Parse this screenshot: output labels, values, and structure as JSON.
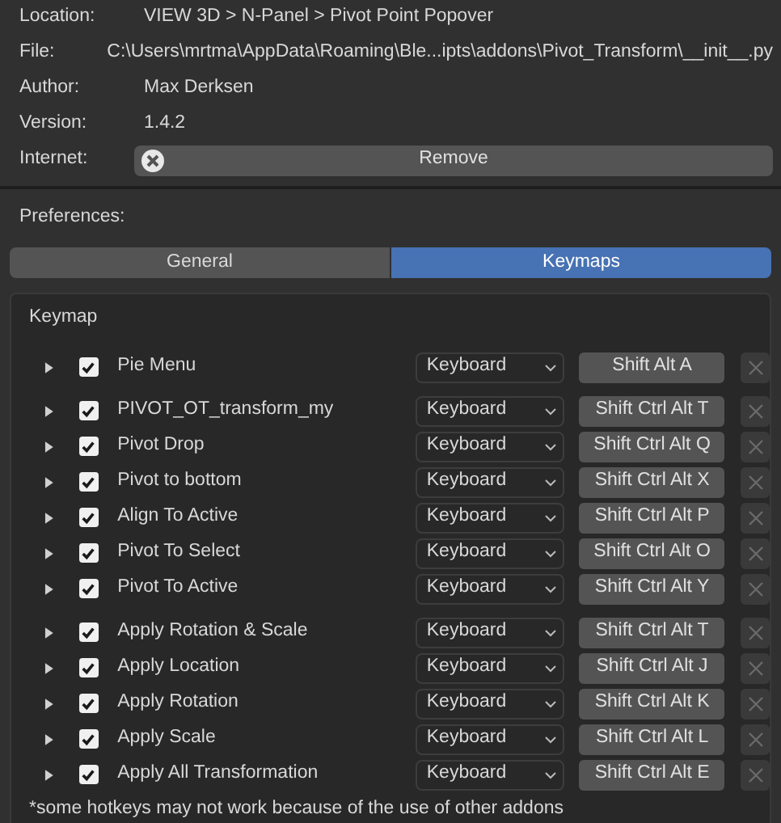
{
  "info": [
    {
      "label": "Location:",
      "value": "VIEW 3D > N-Panel > Pivot Point Popover"
    },
    {
      "label": "File:",
      "value": "C:\\Users\\mrtma\\AppData\\Roaming\\Ble...ipts\\addons\\Pivot_Transform\\__init__.py"
    },
    {
      "label": "Author:",
      "value": "Max Derksen"
    },
    {
      "label": "Version:",
      "value": "1.4.2"
    }
  ],
  "internet": {
    "label": "Internet:",
    "button": "Remove"
  },
  "preferences": {
    "label": "Preferences:"
  },
  "tabs": [
    {
      "label": "General",
      "selected": false
    },
    {
      "label": "Keymaps",
      "selected": true
    }
  ],
  "keymap": {
    "title": "Keymap",
    "groups": [
      [
        {
          "name": "Pie Menu",
          "expanded": false,
          "checked": true,
          "type": "Keyboard",
          "shortcut": "Shift Alt A"
        }
      ],
      [
        {
          "name": "PIVOT_OT_transform_my",
          "expanded": false,
          "checked": true,
          "type": "Keyboard",
          "shortcut": "Shift Ctrl Alt T"
        },
        {
          "name": "Pivot Drop",
          "expanded": false,
          "checked": true,
          "type": "Keyboard",
          "shortcut": "Shift Ctrl Alt Q"
        },
        {
          "name": "Pivot to bottom",
          "expanded": false,
          "checked": true,
          "type": "Keyboard",
          "shortcut": "Shift Ctrl Alt X"
        },
        {
          "name": "Align To Active",
          "expanded": false,
          "checked": true,
          "type": "Keyboard",
          "shortcut": "Shift Ctrl Alt P"
        },
        {
          "name": "Pivot To Select",
          "expanded": false,
          "checked": true,
          "type": "Keyboard",
          "shortcut": "Shift Ctrl Alt O"
        },
        {
          "name": "Pivot To Active",
          "expanded": false,
          "checked": true,
          "type": "Keyboard",
          "shortcut": "Shift Ctrl Alt Y"
        }
      ],
      [
        {
          "name": "Apply Rotation & Scale",
          "expanded": false,
          "checked": true,
          "type": "Keyboard",
          "shortcut": "Shift Ctrl Alt T"
        },
        {
          "name": "Apply Location",
          "expanded": false,
          "checked": true,
          "type": "Keyboard",
          "shortcut": "Shift Ctrl Alt J"
        },
        {
          "name": "Apply Rotation",
          "expanded": false,
          "checked": true,
          "type": "Keyboard",
          "shortcut": "Shift Ctrl Alt K"
        },
        {
          "name": "Apply Scale",
          "expanded": false,
          "checked": true,
          "type": "Keyboard",
          "shortcut": "Shift Ctrl Alt L"
        },
        {
          "name": "Apply All Transformation",
          "expanded": false,
          "checked": true,
          "type": "Keyboard",
          "shortcut": "Shift Ctrl Alt E"
        }
      ]
    ],
    "note": "*some hotkeys may not work because of the use of other addons"
  }
}
